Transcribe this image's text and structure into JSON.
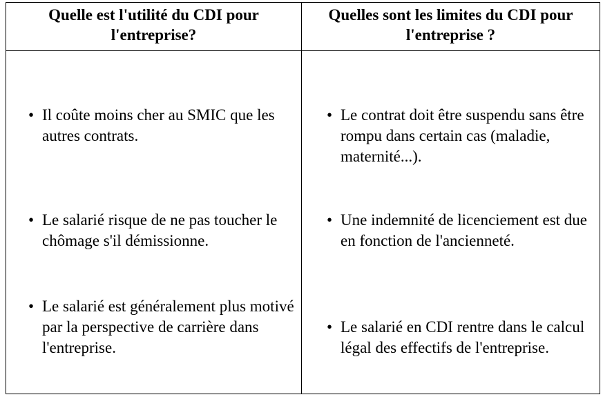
{
  "table": {
    "headers": [
      "Quelle est l'utilité du CDI pour l'entreprise?",
      "Quelles sont les limites du CDI pour l'entreprise ?"
    ],
    "left_items": [
      "Il coûte moins cher au SMIC que les autres contrats.",
      "Le salarié risque de ne pas toucher le chômage s'il démissionne.",
      "Le salarié est généralement plus motivé par la perspective de carrière dans l'entreprise."
    ],
    "right_items": [
      "Le contrat doit être suspendu sans être rompu dans certain cas (maladie, maternité...).",
      "Une indemnité de licenciement est due en fonction de l'ancienneté.",
      "Le salarié en CDI rentre dans le calcul légal des effectifs de l'entreprise."
    ],
    "bullet_glyph": "•"
  }
}
